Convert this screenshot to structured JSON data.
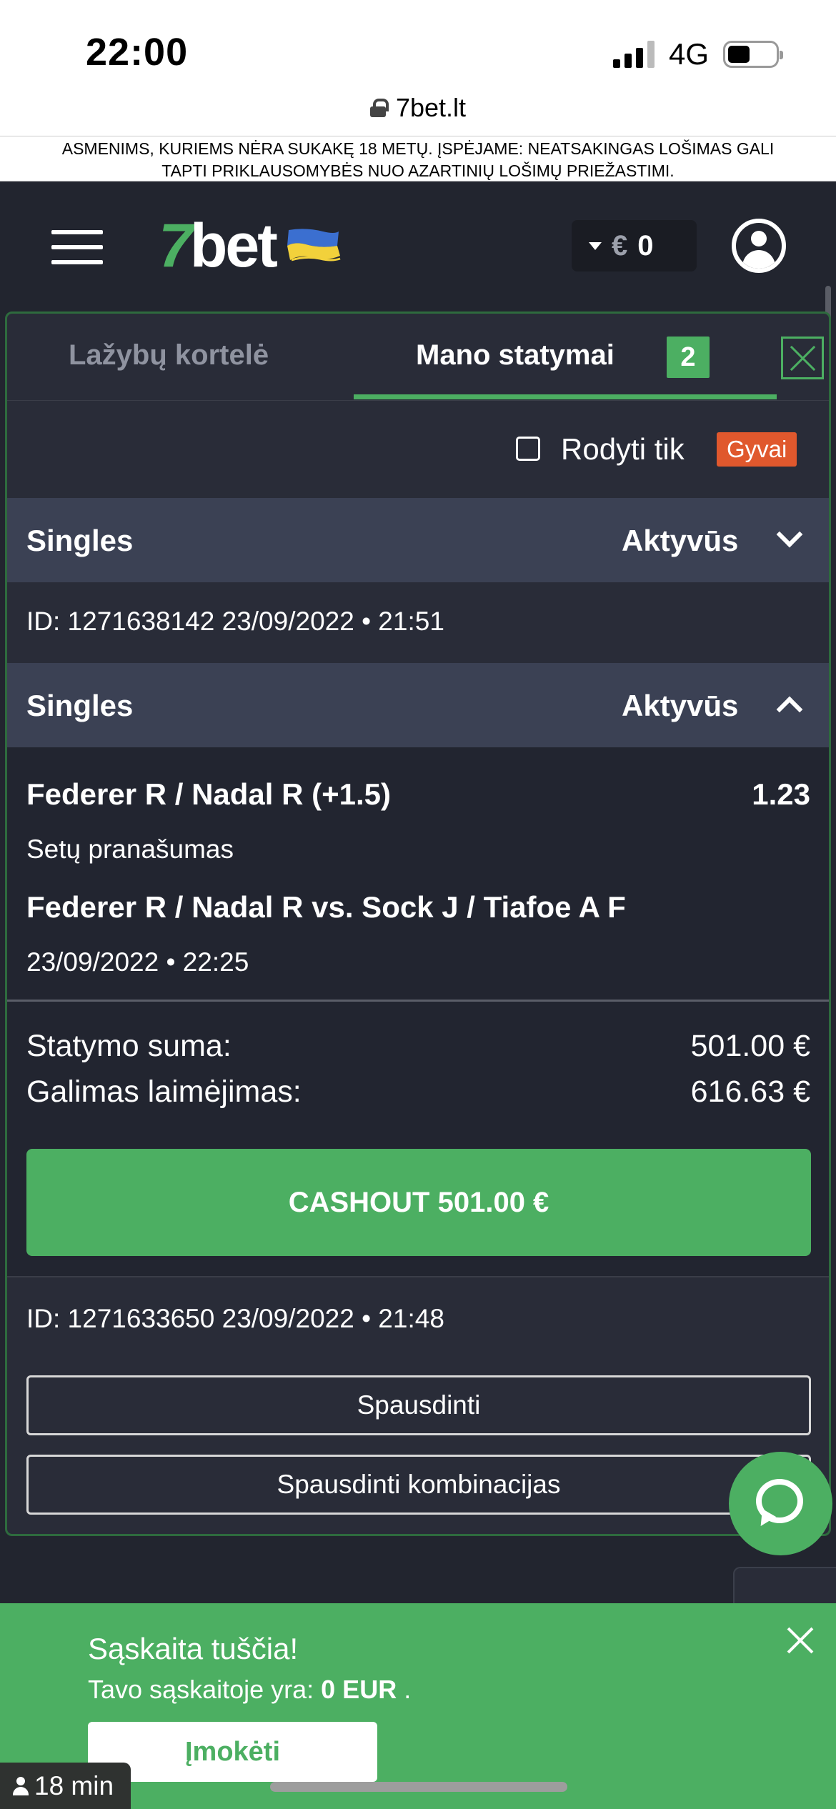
{
  "status_bar": {
    "time": "22:00",
    "network": "4G"
  },
  "browser": {
    "url": "7bet.lt"
  },
  "warning": {
    "line1": "ASMENIMS, KURIEMS NĖRA SUKAKĘ 18 METŲ. ĮSPĖJAME: NEATSAKINGAS LOŠIMAS GALI",
    "line2": "TAPTI PRIKLAUSOMYBĖS NUO AZARTINIŲ LOŠIMŲ PRIEŽASTIMI."
  },
  "header": {
    "logo_seven": "7",
    "logo_bet": "bet",
    "currency": "€",
    "balance": "0"
  },
  "panel": {
    "tabs": [
      {
        "label": "Lažybų kortelė"
      },
      {
        "label": "Mano statymai",
        "badge": "2"
      }
    ],
    "filter": {
      "label": "Rodyti tik",
      "badge": "Gyvai"
    },
    "bets": [
      {
        "type": "Singles",
        "status": "Aktyvūs",
        "id_line": "ID: 1271638142  23/09/2022 • 21:51"
      },
      {
        "type": "Singles",
        "status": "Aktyvūs",
        "selection": "Federer R / Nadal R (+1.5)",
        "odds": "1.23",
        "market": "Setų pranašumas",
        "event": "Federer R / Nadal R vs. Sock J / Tiafoe A F",
        "event_date": "23/09/2022 • 22:25",
        "stake_label": "Statymo suma:",
        "stake_value": "501.00 €",
        "win_label": "Galimas laimėjimas:",
        "win_value": "616.63 €",
        "cashout_label": "CASHOUT 501.00 €",
        "id_line": "ID: 1271633650  23/09/2022 • 21:48"
      }
    ],
    "print_label": "Spausdinti",
    "print_combo_label": "Spausdinti kombinacijas"
  },
  "toast": {
    "title": "Sąskaita tuščia!",
    "text_prefix": "Tavo sąskaitoje yra: ",
    "amount": "0 EUR",
    "text_suffix": " .",
    "deposit_label": "Įmokėti"
  },
  "timer": "18 min",
  "colors": {
    "accent": "#4caf62",
    "live": "#e0582d",
    "background": "#22252f"
  }
}
